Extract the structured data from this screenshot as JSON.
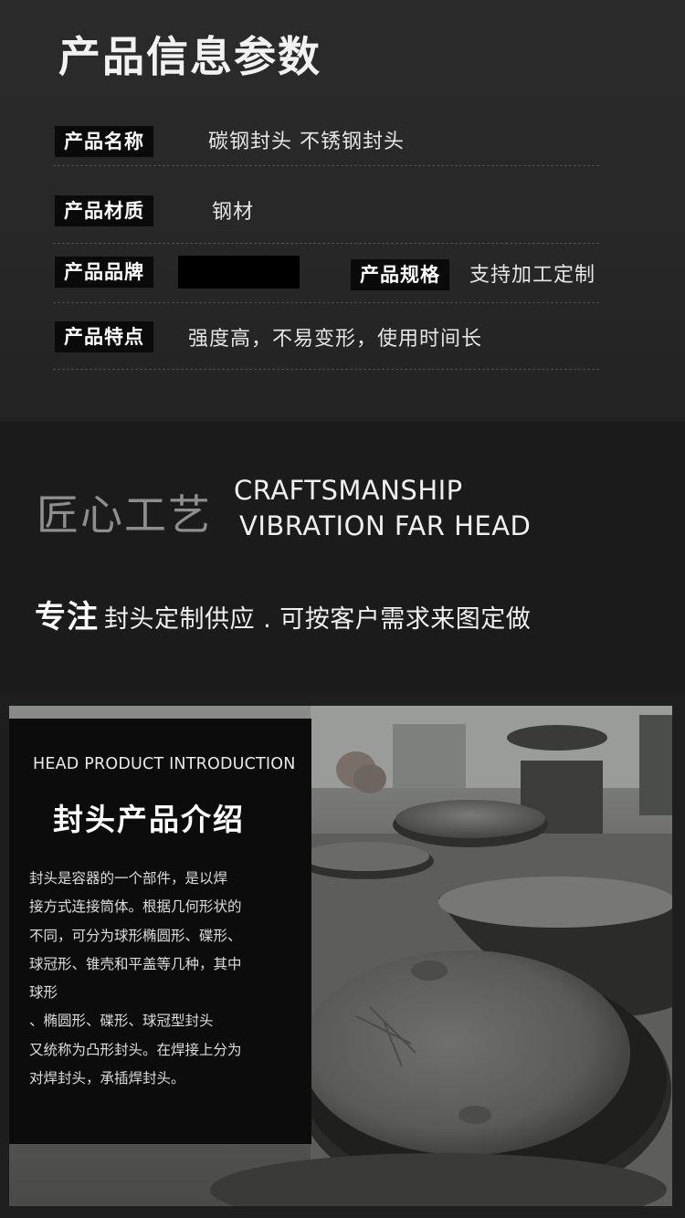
{
  "info": {
    "title": "产品信息参数",
    "rows": [
      {
        "label": "产品名称",
        "value": "碳钢封头  不锈钢封头"
      },
      {
        "label": "产品材质",
        "value": "钢材"
      },
      {
        "label": "产品品牌",
        "value": ""
      },
      {
        "label": "产品特点",
        "value": "强度高，不易变形，使用时间长"
      }
    ],
    "spec": {
      "label": "产品规格",
      "value": "支持加工定制"
    }
  },
  "craft": {
    "title_cn": "匠心工艺",
    "title_en_1": "CRAFTSMANSHIP",
    "title_en_2": "VIBRATION FAR HEAD",
    "focus_strong": "专注",
    "focus_rest": "封头定制供应 . 可按客户需求来图定做"
  },
  "intro": {
    "title_en": "HEAD PRODUCT INTRODUCTION",
    "title_cn": "封头产品介绍",
    "body_lines": [
      "封头是容器的一个部件，是以焊",
      "接方式连接筒体。根据几何形状的",
      "不同，可分为球形椭圆形、碟形、",
      "球冠形、锥壳和平盖等几种，其中",
      "球形",
      "、椭圆形、碟形、球冠型封头",
      "又统称为凸形封头。在焊接上分为",
      "对焊封头，承插焊封头。"
    ]
  },
  "colors": {
    "tag_bg": "#0a0a0a",
    "panel_bg": "#0c0c0c",
    "page_bg": "#1c1c1c"
  }
}
